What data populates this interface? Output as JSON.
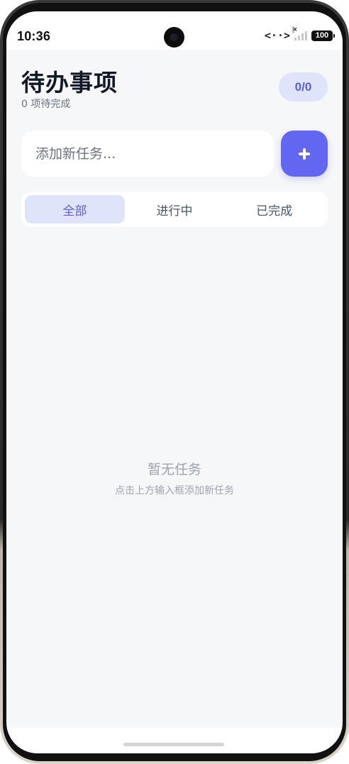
{
  "status_bar": {
    "time": "10:36",
    "battery": "100"
  },
  "header": {
    "title": "待办事项",
    "subtitle": "0 项待完成",
    "count_badge": "0/0"
  },
  "input": {
    "placeholder": "添加新任务...",
    "value": ""
  },
  "add_button": {
    "icon": "plus-icon"
  },
  "tabs": [
    {
      "label": "全部",
      "active": true
    },
    {
      "label": "进行中",
      "active": false
    },
    {
      "label": "已完成",
      "active": false
    }
  ],
  "empty_state": {
    "title": "暂无任务",
    "hint": "点击上方输入框添加新任务"
  },
  "colors": {
    "accent": "#6366f1",
    "accent_light": "#e0e4fb",
    "background": "#f6f7f9"
  }
}
